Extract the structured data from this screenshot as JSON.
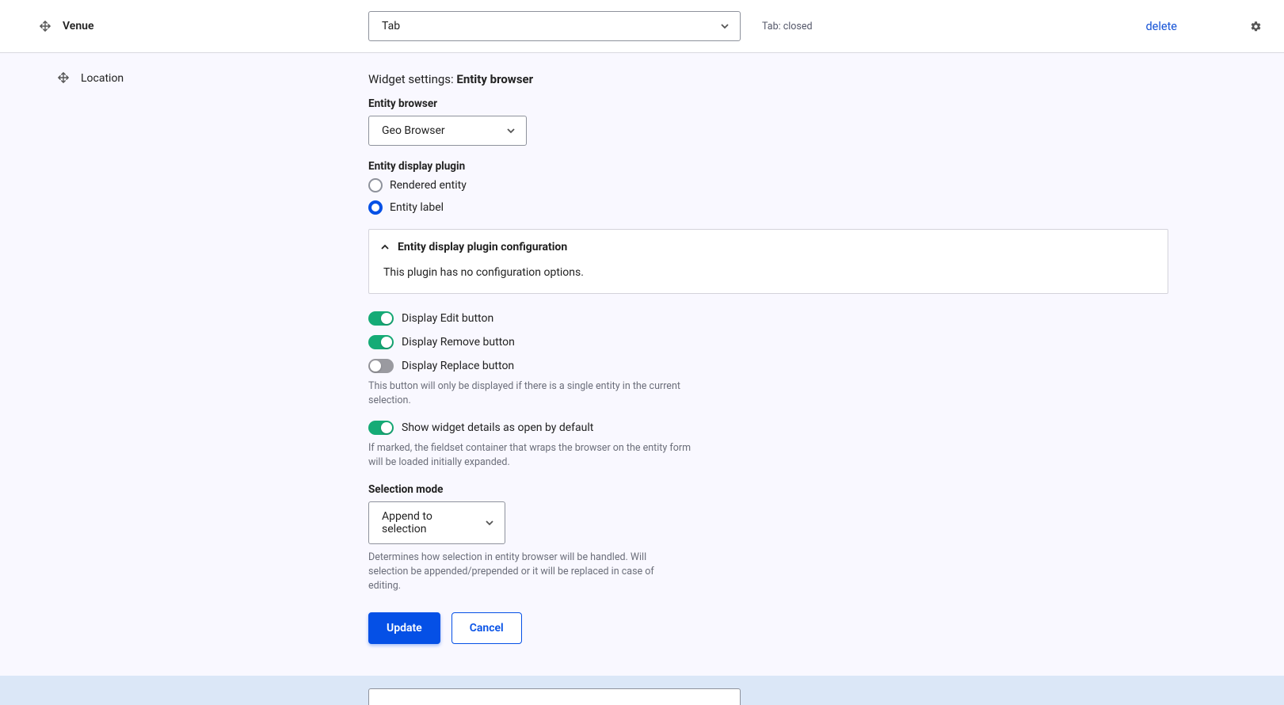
{
  "venue_row": {
    "label": "Venue",
    "select_value": "Tab",
    "status": "Tab: closed",
    "delete": "delete"
  },
  "location_row": {
    "label": "Location"
  },
  "widget": {
    "heading_prefix": "Widget settings: ",
    "heading_name": "Entity browser",
    "entity_browser_label": "Entity browser",
    "entity_browser_value": "Geo Browser",
    "display_plugin_label": "Entity display plugin",
    "radio1": "Rendered entity",
    "radio2": "Entity label",
    "fieldset_title": "Entity display plugin configuration",
    "fieldset_body": "This plugin has no configuration options.",
    "toggle_edit": "Display Edit button",
    "toggle_remove": "Display Remove button",
    "toggle_replace": "Display Replace button",
    "replace_help": "This button will only be displayed if there is a single entity in the current selection.",
    "toggle_openwidget": "Show widget details as open by default",
    "openwidget_help": "If marked, the fieldset container that wraps the browser on the entity form will be loaded initially expanded.",
    "selection_mode_label": "Selection mode",
    "selection_mode_value": "Append to selection",
    "selection_mode_help": "Determines how selection in entity browser will be handled. Will selection be appended/prepended or it will be replaced in case of editing.",
    "update": "Update",
    "cancel": "Cancel"
  }
}
